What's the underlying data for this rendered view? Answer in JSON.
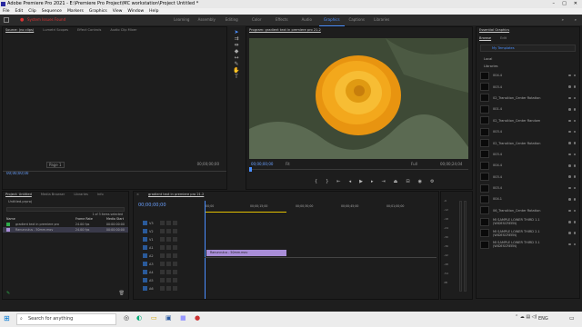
{
  "window": {
    "title": "Adobe Premiere Pro 2021 - E:\\Premiere Pro Project\\MC workstation\\Project Untitled *"
  },
  "menu": [
    "File",
    "Edit",
    "Clip",
    "Sequence",
    "Markers",
    "Graphics",
    "View",
    "Window",
    "Help"
  ],
  "workspace": {
    "warning": "System Issues Found",
    "tabs": [
      "Learning",
      "Assembly",
      "Editing",
      "Color",
      "Effects",
      "Audio",
      "Graphics",
      "Captions",
      "Libraries"
    ],
    "active": "Graphics"
  },
  "source": {
    "tabs": [
      "Source: (no clips)",
      "Lumetri Scopes",
      "Effect Controls",
      "Audio Clip Mixer"
    ],
    "tc_left": "00;00;00;00",
    "tc_right": "00;00;00;00",
    "page": "Page 1"
  },
  "program": {
    "title": "Program: gradient text in premiere pro 21.2",
    "tc_left": "00;00;00;00",
    "fit": "Fit",
    "quality": "Full",
    "tc_right": "00;00;24;04"
  },
  "essential": {
    "title": "Essential Graphics",
    "tabs": [
      "Browse",
      "Edit"
    ],
    "my_templates": "My Templates",
    "local_label": "Local",
    "libraries_label": "Libraries",
    "items": [
      "004.4",
      "003.4",
      "02_Transition_Center Rotation",
      "001.4",
      "02_Transition_Center Random",
      "003.4",
      "02_Transition_Center Rotation",
      "003.4",
      "004.4",
      "003.4",
      "003.4",
      "004.1",
      "06_Transition_Center Rotation",
      "MI SAMPLE LOWER THIRD 1.1 (WIDESCREEN)",
      "MI SAMPLE LOWER THIRD 2.1 (WIDESCREEN)",
      "MI SAMPLE LOWER THIRD 3.1 (WIDESCREEN)"
    ]
  },
  "project": {
    "tabs": [
      "Project: Untitled",
      "Media Browser",
      "Libraries",
      "Info"
    ],
    "file": "Untitled.prproj",
    "items_selected": "1 of 3 items selected",
    "headers": [
      "Name",
      "Frame Rate",
      "Media Start"
    ],
    "rows": [
      {
        "name": "gradient text in premiere pro",
        "rate": "24.00 fps",
        "start": "00:00:00:00"
      },
      {
        "name": "Ranunculus - 50mm.mov",
        "rate": "24.00 fps",
        "start": "00:00:00:00"
      }
    ]
  },
  "timeline": {
    "tab": "gradient text in premiere pro 21.2",
    "tc": "00;00;00;00",
    "ruler": [
      ":00;00",
      "00;00;15;00",
      "00;00;30;00",
      "00;00;45;00",
      "00;01;00;00"
    ],
    "clip": "Ranunculus - 50mm.mov",
    "tracks": [
      "V3",
      "V2",
      "V1",
      "A1",
      "A2",
      "A3",
      "A4",
      "A5",
      "A6"
    ]
  },
  "meter": {
    "labels": [
      "-6",
      "-12",
      "-18",
      "-24",
      "-30",
      "-36",
      "-42",
      "-48",
      "-54",
      "dB"
    ]
  },
  "taskbar": {
    "search": "Search for anything",
    "lang": "ENG"
  },
  "colors": {
    "accent": "#4a8fff",
    "clip": "#a98ed8",
    "timecode": "#6aa0ff"
  }
}
